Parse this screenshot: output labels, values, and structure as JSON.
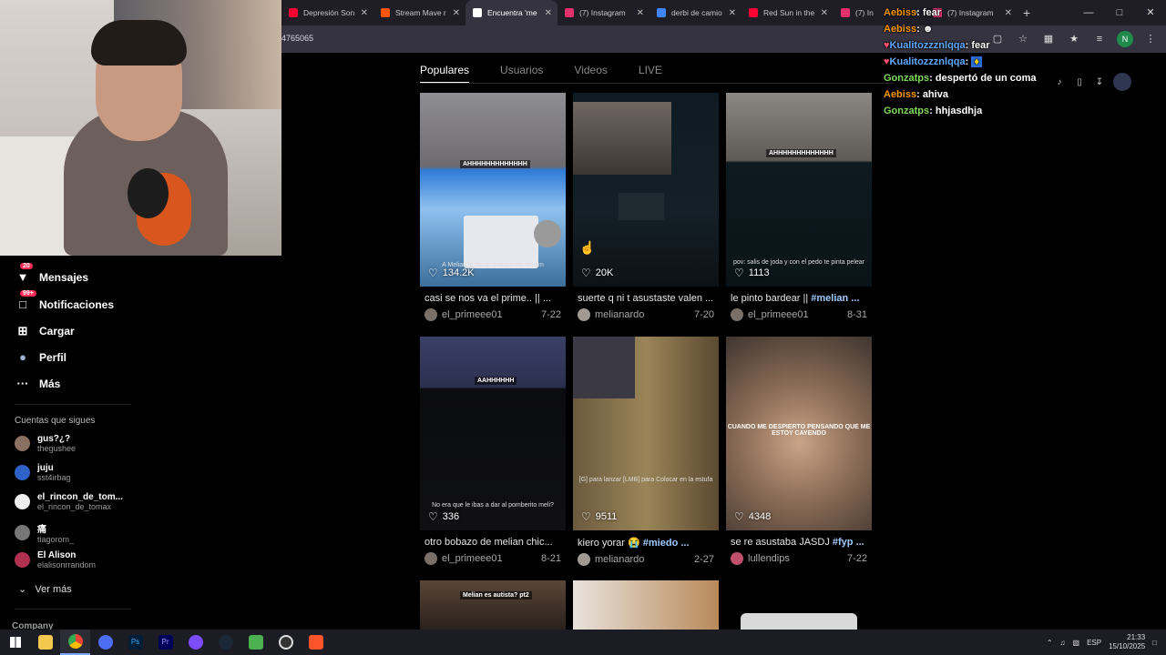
{
  "browser": {
    "tabs": [
      {
        "title": "Depresión Son",
        "color": "#ff0033"
      },
      {
        "title": "Stream Mave r",
        "color": "#ff5500"
      },
      {
        "title": "Encuentra 'me",
        "color": "#ffffff"
      },
      {
        "title": "(7) Instagram",
        "color": "#e1306c"
      },
      {
        "title": "derbi de camio",
        "color": "#4285f4"
      },
      {
        "title": "Red Sun in the",
        "color": "#ff0033"
      },
      {
        "title": "(7) In",
        "color": "#e1306c"
      },
      {
        "title": "(7) Instagram",
        "color": "#e1306c"
      }
    ],
    "url": "4765065",
    "profile_initial": "N"
  },
  "tiktok": {
    "tabs": [
      "Populares",
      "Usuarios",
      "Videos",
      "LIVE"
    ],
    "active_tab": "Populares",
    "videos": [
      {
        "likes": "134.2K",
        "caption": "casi se nos va el prime.. || ...",
        "tag": "",
        "author": "el_primeee01",
        "date": "7-22",
        "stamp": "AHHHHHHHHHHHHH",
        "subcap": "A Melian le da un bobazo en stream"
      },
      {
        "likes": "20K",
        "caption": "suerte q ni t asustaste valen ...",
        "tag": "",
        "author": "melianardo",
        "date": "7-20",
        "stamp": "",
        "subcap": ""
      },
      {
        "likes": "1113",
        "caption": "le pinto bardear || ",
        "tag": "#melian ...",
        "author": "el_primeee01",
        "date": "8-31",
        "stamp": "AHHHHHHHHHHHHH",
        "subcap": "pov: salis de joda y con el pedo te pinta pelear"
      },
      {
        "likes": "336",
        "caption": "otro bobazo de melian chic...",
        "tag": "",
        "author": "el_primeee01",
        "date": "8-21",
        "stamp": "AAHHHHHH",
        "subcap": "No era que le ibas a dar al pomberito meli?"
      },
      {
        "likes": "9511",
        "caption": "kiero yorar 😭 ",
        "tag": "#miedo ...",
        "author": "melianardo",
        "date": "2-27",
        "stamp": "",
        "subcap": "[G] para lanzar [LMB] para Colocar en la estufa"
      },
      {
        "likes": "4348",
        "caption": "se re asustaba JASDJ ",
        "tag": "#fyp ...",
        "author": "lullendips",
        "date": "7-22",
        "stamp": "",
        "subcap": "CUANDO ME DESPIERTO PENSANDO QUE ME ESTOY CAYENDO"
      },
      {
        "stamp": "Melian es autista? pt2"
      }
    ]
  },
  "sidebar": {
    "nav": [
      {
        "label": "Mensajes",
        "icon": "send-icon",
        "badge": "20"
      },
      {
        "label": "Notificaciones",
        "icon": "inbox-icon",
        "badge": "99+"
      },
      {
        "label": "Cargar",
        "icon": "upload-icon",
        "badge": ""
      },
      {
        "label": "Perfil",
        "icon": "profile-icon",
        "badge": ""
      },
      {
        "label": "Más",
        "icon": "more-icon",
        "badge": ""
      }
    ],
    "following_title": "Cuentas que sigues",
    "following": [
      {
        "name": "gus?¿?",
        "handle": "thegushee"
      },
      {
        "name": "juju",
        "handle": "sst4irbag"
      },
      {
        "name": "el_rincon_de_tom...",
        "handle": "el_rincon_de_tomax"
      },
      {
        "name": "痛",
        "handle": "tiagorom_"
      },
      {
        "name": "El Alison",
        "handle": "elalisonrrandom"
      }
    ],
    "see_more": "Ver más",
    "company": "Company"
  },
  "chat": [
    {
      "user": "Aebiss",
      "msg": "fear",
      "color": "orange"
    },
    {
      "user": "Aebiss",
      "msg": "",
      "color": "orange"
    },
    {
      "user": "Kualitozzznlqqa",
      "msg": "fear",
      "color": "blue"
    },
    {
      "user": "Kualitozzznlqqa",
      "msg": "",
      "color": "blue"
    },
    {
      "user": "Gonzatps",
      "msg": "despertó de un coma",
      "color": "green"
    },
    {
      "user": "Aebiss",
      "msg": "ahiva",
      "color": "orange"
    },
    {
      "user": "Gonzatps",
      "msg": "hhjasdhja",
      "color": "green"
    }
  ],
  "taskbar": {
    "lang": "ESP",
    "time": "21:33",
    "date": "15/10/2025"
  }
}
